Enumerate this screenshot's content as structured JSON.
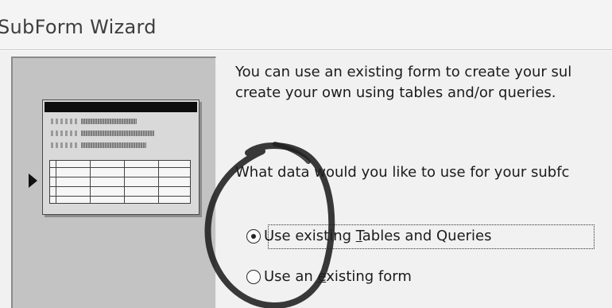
{
  "window": {
    "title": "SubForm Wizard"
  },
  "intro": {
    "line1": "You can use an existing form to create your sul",
    "line2": "create your own using tables and/or queries."
  },
  "question": "What data would you like to use for your subfc",
  "options": [
    {
      "before": "Use ex",
      "mnemonic": "",
      "rest": "isting ",
      "mn2": "T",
      "after": "ables and Queries",
      "selected": true
    },
    {
      "before": "Use an ",
      "mnemonic": "e",
      "after": "xisting form",
      "selected": false
    }
  ],
  "icons": {
    "pointer": "triangle-right-icon",
    "radio_on": "radio-selected-icon",
    "radio_off": "radio-unselected-icon"
  },
  "colors": {
    "annotation_stroke": "#1e1e1e",
    "preview_panel": "#c3c3c3"
  }
}
